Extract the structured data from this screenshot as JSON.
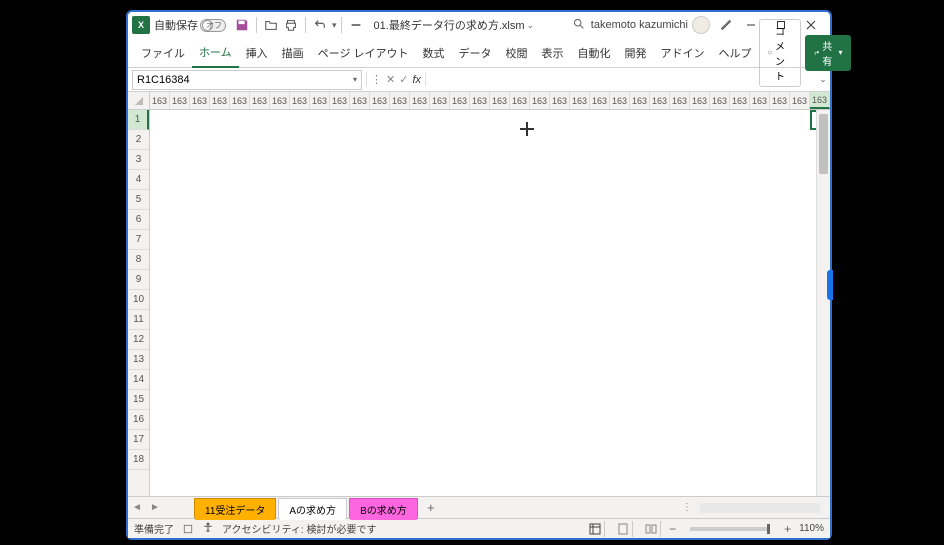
{
  "titlebar": {
    "autosave_label": "自動保存",
    "autosave_state": "オフ",
    "filename": "01.最終データ行の求め方.xlsm",
    "username": "takemoto kazumichi"
  },
  "ribbon": {
    "tabs": [
      "ファイル",
      "ホーム",
      "挿入",
      "描画",
      "ページ レイアウト",
      "数式",
      "データ",
      "校閲",
      "表示",
      "自動化",
      "開発",
      "アドイン",
      "ヘルプ"
    ],
    "comment_label": "コメント",
    "share_label": "共有"
  },
  "formula": {
    "name_box": "R1C16384",
    "value": ""
  },
  "grid": {
    "col_label": "163",
    "visible_row_count": 18,
    "row_labels": [
      1,
      2,
      3,
      4,
      5,
      6,
      7,
      8,
      9,
      10,
      11,
      12,
      13,
      14,
      15,
      16,
      17,
      18
    ]
  },
  "sheets": {
    "tabs": [
      "11受注データ",
      "Aの求め方",
      "Bの求め方"
    ],
    "add": "+"
  },
  "status": {
    "ready": "準備完了",
    "accessibility": "アクセシビリティ: 検討が必要です",
    "zoom": "110%"
  }
}
